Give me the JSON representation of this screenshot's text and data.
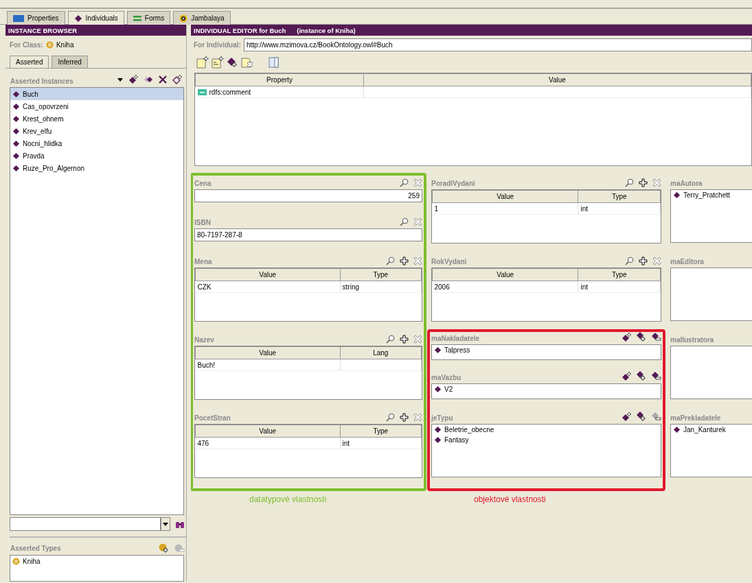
{
  "tabs": [
    {
      "label": "Properties",
      "kind": "slot",
      "selected": false
    },
    {
      "label": "Individuals",
      "kind": "instance",
      "selected": true
    },
    {
      "label": "Forms",
      "kind": "form",
      "selected": false
    },
    {
      "label": "Jambalaya",
      "kind": "graph",
      "selected": false
    }
  ],
  "instance_browser": {
    "title": "INSTANCE BROWSER",
    "for_class_label": "For Class:",
    "for_class": "Kniha",
    "subtabs": [
      {
        "label": "Asserted",
        "selected": true
      },
      {
        "label": "Inferred",
        "selected": false
      }
    ],
    "instances_label": "Asserted Instances",
    "instance_tools": [
      {
        "kind": "menu"
      },
      {
        "kind": "create"
      },
      {
        "kind": "copy"
      },
      {
        "kind": "delete"
      },
      {
        "kind": "edit"
      }
    ],
    "instances": [
      {
        "name": "Buch",
        "selected": true
      },
      {
        "name": "Cas_opovrzeni",
        "selected": false
      },
      {
        "name": "Krest_ohnem",
        "selected": false
      },
      {
        "name": "Krev_elfu",
        "selected": false
      },
      {
        "name": "Nocni_hlidka",
        "selected": false
      },
      {
        "name": "Pravda",
        "selected": false
      },
      {
        "name": "Ruze_Pro_Algernon",
        "selected": false
      }
    ],
    "types_label": "Asserted Types",
    "type_tools": [
      {
        "kind": "add",
        "disabled": false
      },
      {
        "kind": "remove",
        "disabled": true
      }
    ],
    "types": [
      "Kniha"
    ]
  },
  "editor": {
    "title": "INDIVIDUAL EDITOR for Buch",
    "subtitle": "(instance of Kniha)",
    "for_individual_label": "For Individual:",
    "uri": "http://www.mzimova.cz/BookOntology.owl#Buch",
    "toolbar": [
      {
        "kind": "note"
      },
      {
        "kind": "document"
      },
      {
        "kind": "instance"
      },
      {
        "kind": "delete"
      },
      {
        "kind": "layout"
      }
    ],
    "property_table": {
      "columns": [
        "Property",
        "Value"
      ],
      "rows": [
        [
          "rdfs:comment"
        ]
      ]
    },
    "columns": [
      {
        "groups": [
          {
            "annotation": {
              "text": "datatypové vlastnosti",
              "color": "#7cbf2e"
            },
            "widgets": [
              {
                "kind": "field",
                "label": "Cena",
                "value": "259",
                "tools": [
                  {
                    "kind": "find",
                    "disabled": false
                  },
                  {
                    "kind": "remove",
                    "disabled": false
                  }
                ]
              },
              {
                "kind": "field",
                "label": "ISBN",
                "value": "80-7197-287-8",
                "tools": [
                  {
                    "kind": "find",
                    "disabled": false
                  },
                  {
                    "kind": "remove",
                    "disabled": false
                  }
                ]
              },
              {
                "kind": "table",
                "label": "Mena",
                "columns": [
                  "Value",
                  "Type"
                ],
                "rows": [
                  [
                    "CZK",
                    "string"
                  ]
                ],
                "tools": [
                  {
                    "kind": "find",
                    "disabled": false
                  },
                  {
                    "kind": "add",
                    "disabled": false
                  },
                  {
                    "kind": "remove",
                    "disabled": false
                  }
                ]
              },
              {
                "kind": "table",
                "label": "Nazev",
                "columns": [
                  "Value",
                  "Lang"
                ],
                "rows": [
                  [
                    "Buch!"
                  ]
                ],
                "tools": [
                  {
                    "kind": "find",
                    "disabled": false
                  },
                  {
                    "kind": "add",
                    "disabled": false
                  },
                  {
                    "kind": "remove",
                    "disabled": false
                  }
                ]
              },
              {
                "kind": "table",
                "label": "PocetStran",
                "columns": [
                  "Value",
                  "Type"
                ],
                "rows": [
                  [
                    "476",
                    "int"
                  ]
                ],
                "tools": [
                  {
                    "kind": "find",
                    "disabled": false
                  },
                  {
                    "kind": "add",
                    "disabled": false
                  },
                  {
                    "kind": "remove",
                    "disabled": false
                  }
                ]
              }
            ]
          }
        ]
      },
      {
        "groups": [
          {
            "widgets": [
              {
                "kind": "table",
                "label": "PoradiVydani",
                "columns": [
                  "Value",
                  "Type"
                ],
                "rows": [
                  [
                    "1",
                    "int"
                  ]
                ],
                "tools": [
                  {
                    "kind": "find",
                    "disabled": false
                  },
                  {
                    "kind": "add",
                    "disabled": false
                  },
                  {
                    "kind": "remove",
                    "disabled": false
                  }
                ]
              },
              {
                "kind": "table",
                "label": "RokVydani",
                "columns": [
                  "Value",
                  "Type"
                ],
                "rows": [
                  [
                    "2006",
                    "int"
                  ]
                ],
                "tools": [
                  {
                    "kind": "find",
                    "disabled": false
                  },
                  {
                    "kind": "add",
                    "disabled": false
                  },
                  {
                    "kind": "remove",
                    "disabled": false
                  }
                ]
              }
            ]
          },
          {
            "annotation": {
              "text": "objektové vlastnosti",
              "color": "#e0182d"
            },
            "widgets": [
              {
                "kind": "list",
                "label": "maNakladatele",
                "items": [
                  "Talpress"
                ],
                "tools": [
                  {
                    "kind": "create",
                    "disabled": false
                  },
                  {
                    "kind": "add",
                    "disabled": false
                  },
                  {
                    "kind": "remove",
                    "disabled": false
                  }
                ]
              },
              {
                "kind": "list",
                "label": "maVazbu",
                "items": [
                  "V2"
                ],
                "tools": [
                  {
                    "kind": "create",
                    "disabled": false
                  },
                  {
                    "kind": "add",
                    "disabled": false
                  },
                  {
                    "kind": "remove",
                    "disabled": false
                  }
                ]
              },
              {
                "kind": "list",
                "label": "jeTypu",
                "items": [
                  "Beletrie_obecne",
                  "Fantasy"
                ],
                "tools": [
                  {
                    "kind": "create",
                    "disabled": false
                  },
                  {
                    "kind": "add",
                    "disabled": false
                  },
                  {
                    "kind": "remove",
                    "disabled": true
                  }
                ]
              }
            ]
          }
        ]
      },
      {
        "groups": [
          {
            "widgets": [
              {
                "kind": "list",
                "label": "maAutora",
                "items": [
                  "Terry_Pratchett"
                ]
              },
              {
                "kind": "list",
                "label": "maEditora"
              },
              {
                "kind": "list",
                "label": "maIlustratora"
              },
              {
                "kind": "list",
                "label": "maPrekladatele",
                "items": [
                  "Jan_Kanturek"
                ]
              }
            ]
          }
        ]
      }
    ]
  }
}
